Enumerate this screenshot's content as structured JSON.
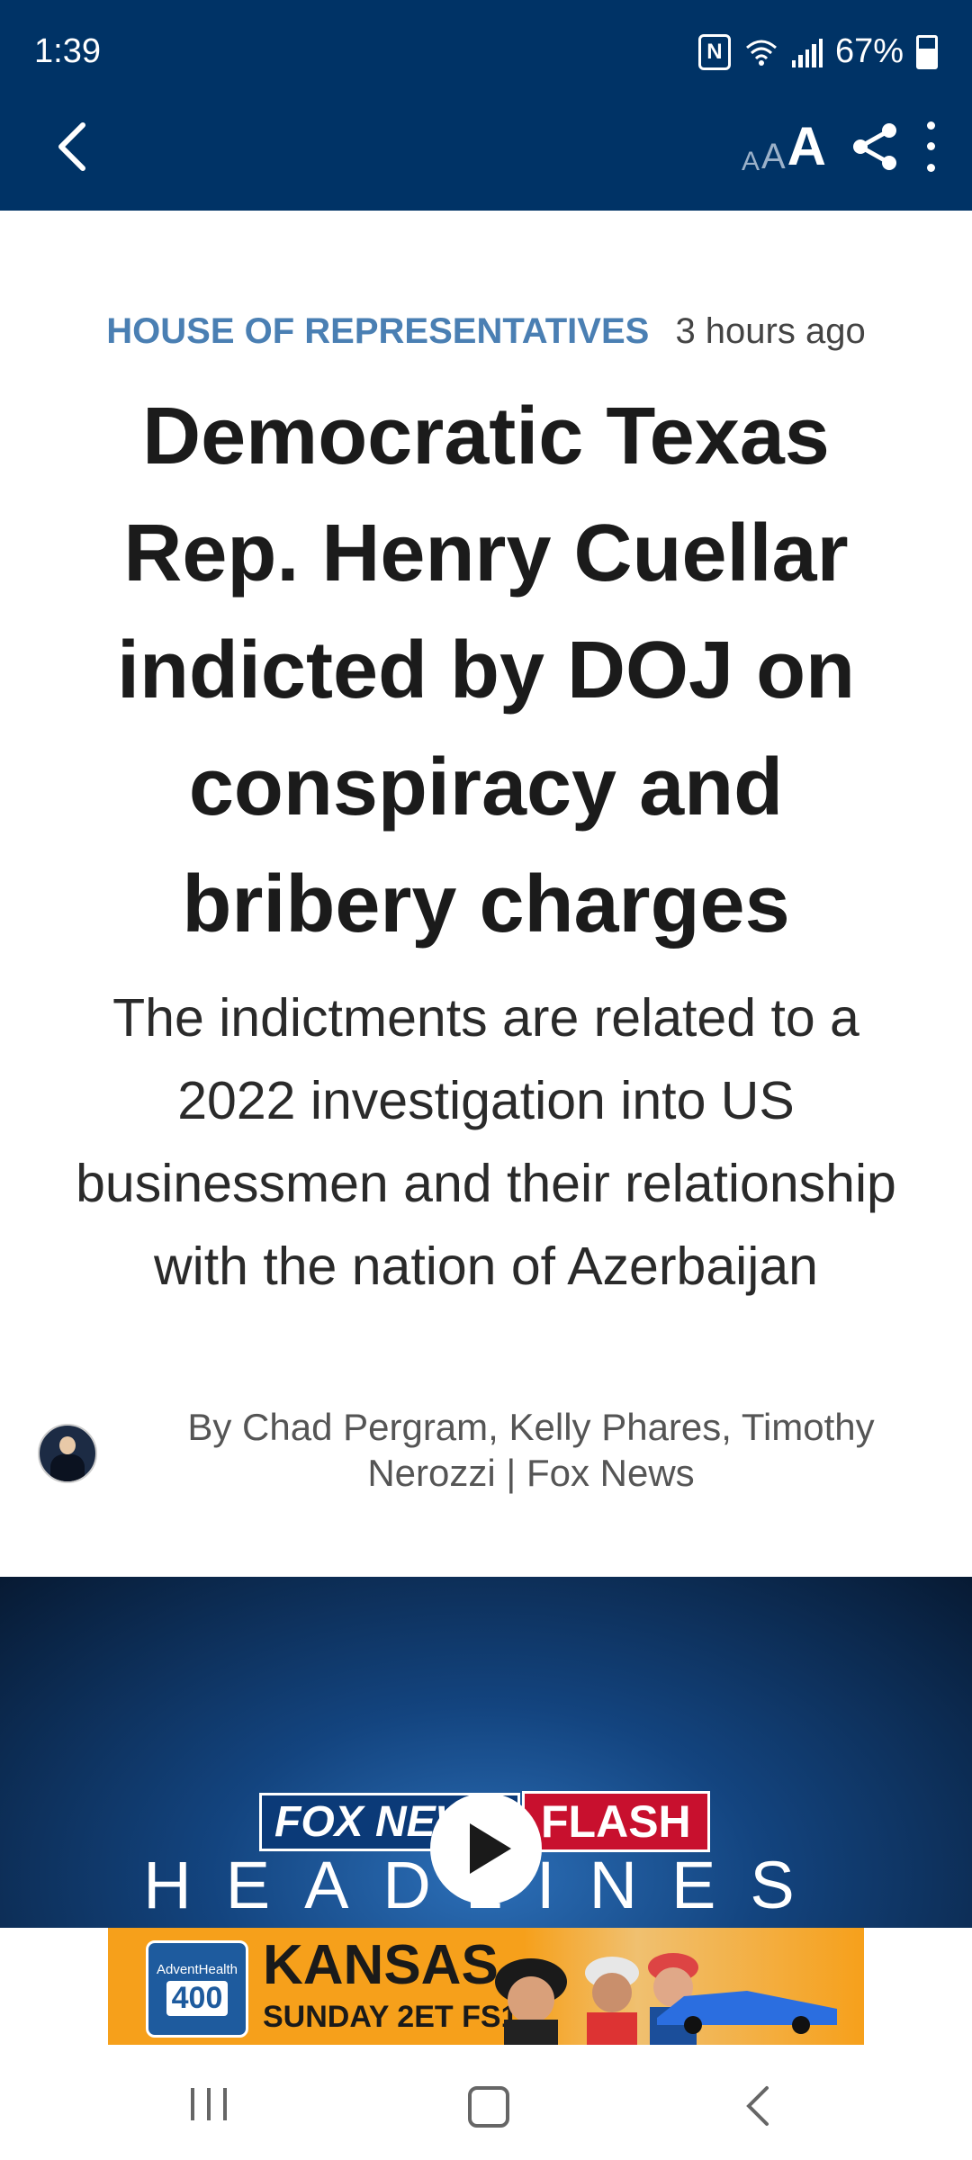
{
  "status_bar": {
    "time": "1:39",
    "battery": "67%"
  },
  "toolbar": {
    "text_size_small": "A",
    "text_size_medium": "A",
    "text_size_large": "A"
  },
  "article": {
    "category": "HOUSE OF REPRESENTATIVES",
    "time_ago": "3 hours ago",
    "headline": "Democratic Texas Rep. Henry Cuellar indicted by DOJ on conspiracy and bribery charges",
    "subheadline": "The indictments are related to a 2022 investigation into US businessmen and their relationship with the nation of Azerbaijan",
    "byline": "By Chad Pergram, Kelly Phares, Timothy Nerozzi | Fox News"
  },
  "video": {
    "brand": "FOX NEWS",
    "flash": "FLASH",
    "headlines": "HEADLINES"
  },
  "ad": {
    "logo_top": "AdventHealth",
    "logo_number": "400",
    "title": "KANSAS",
    "subtitle": "SUNDAY 2ET FS1"
  },
  "colors": {
    "header_bg": "#003366",
    "category": "#4a7fb3",
    "flash_red": "#c8102e"
  }
}
